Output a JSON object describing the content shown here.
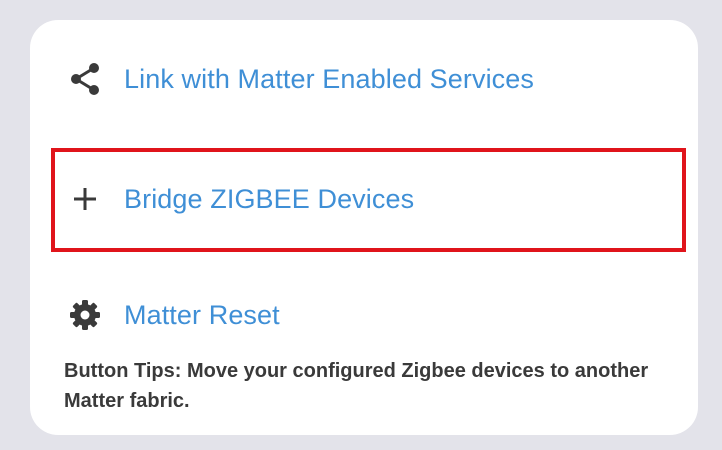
{
  "menu": {
    "link_label": "Link with Matter Enabled Services",
    "bridge_label": "Bridge ZIGBEE Devices",
    "reset_label": "Matter Reset"
  },
  "tips": {
    "text": "Button Tips: Move your configured Zigbee devices to another Matter fabric."
  },
  "icons": {
    "link": "share-icon",
    "bridge": "plus-icon",
    "reset": "gear-icon"
  },
  "colors": {
    "accent": "#3f8fd6",
    "highlight": "#e0141b",
    "background": "#e3e3ea",
    "card": "#ffffff"
  }
}
